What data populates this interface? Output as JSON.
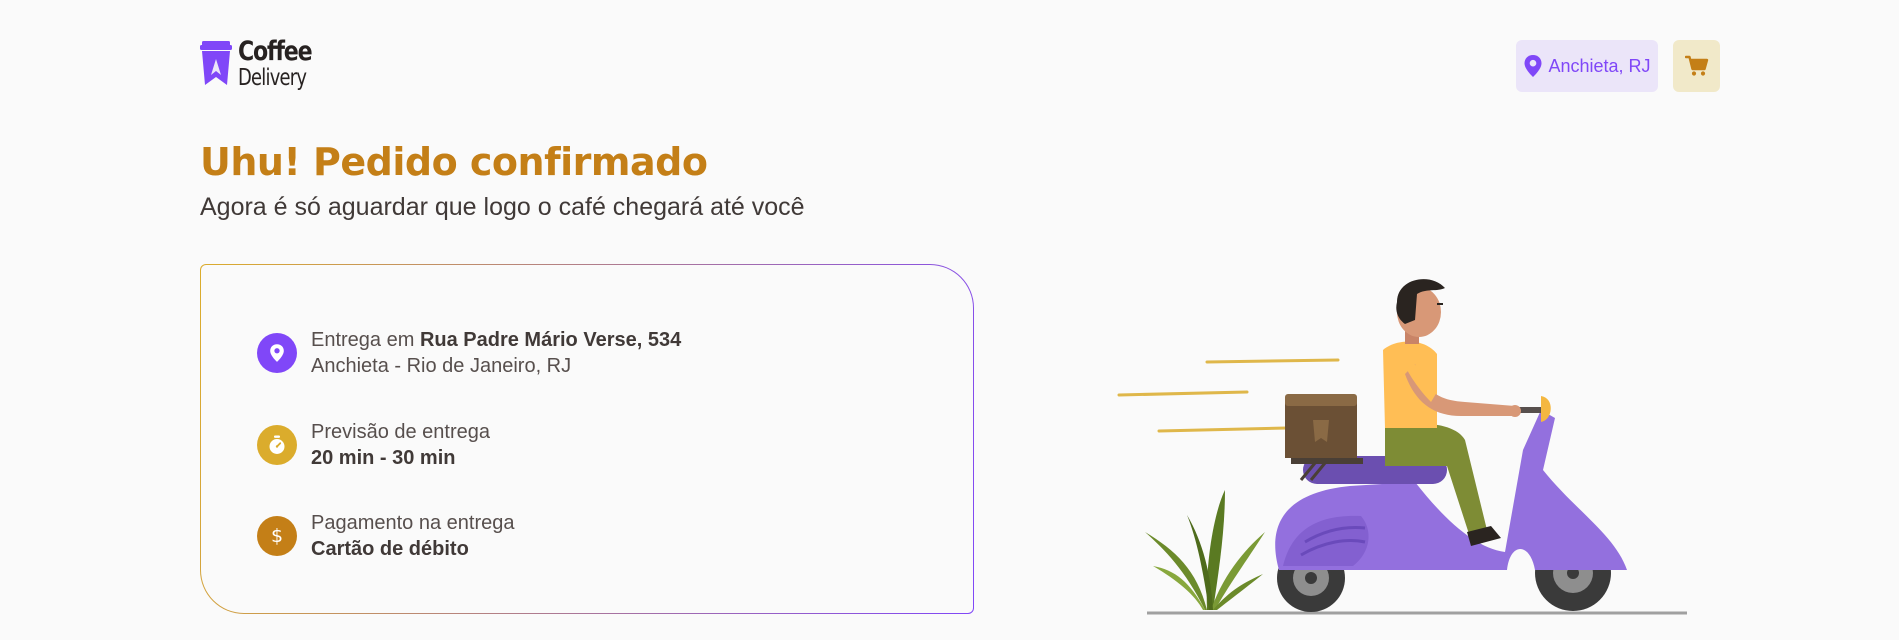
{
  "header": {
    "logo": {
      "line1": "Coffee",
      "line2": "Delivery"
    },
    "location": "Anchieta, RJ",
    "cart_icon": "shopping-cart-icon"
  },
  "confirmation": {
    "title": "Uhu! Pedido confirmado",
    "subtitle": "Agora é só aguardar que logo o café chegará até você"
  },
  "order_info": {
    "delivery": {
      "icon": "map-pin-icon",
      "prefix": "Entrega em ",
      "street": "Rua Padre Mário Verse, 534",
      "city": "Anchieta - Rio de Janeiro, RJ"
    },
    "estimate": {
      "icon": "timer-icon",
      "label": "Previsão de entrega",
      "value": "20 min - 30 min"
    },
    "payment": {
      "icon": "currency-dollar-icon",
      "label": "Pagamento na entrega",
      "value": "Cartão de débito"
    }
  },
  "colors": {
    "brand_purple": "#8047f8",
    "brand_yellow": "#dbac2c",
    "brand_yellow_dark": "#c47f17",
    "purple_light": "#ebe5f9",
    "yellow_light": "#f1e9c9"
  },
  "illustration": {
    "icon": "delivery-scooter-illustration"
  }
}
